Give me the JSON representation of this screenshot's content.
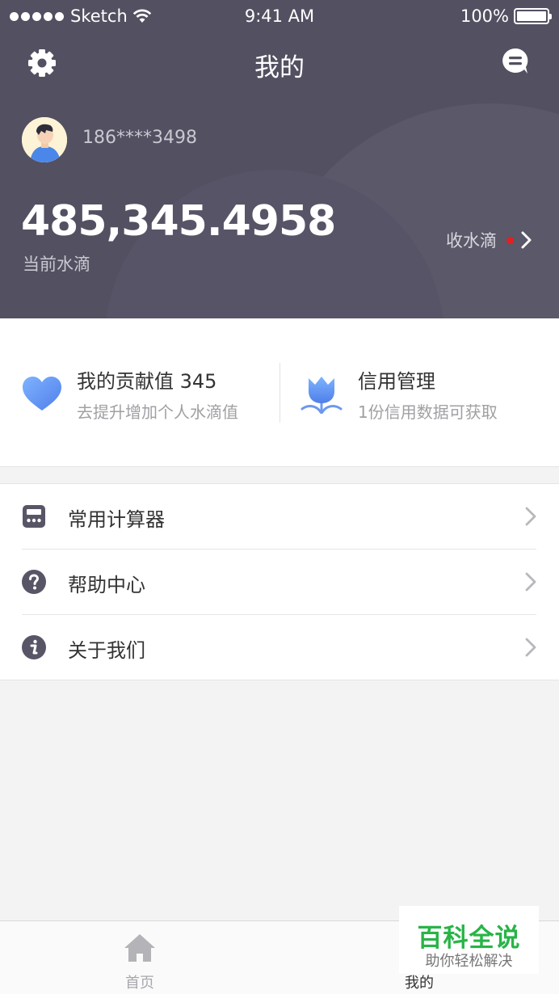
{
  "status_bar": {
    "carrier": "Sketch",
    "time": "9:41 AM",
    "battery": "100%"
  },
  "header": {
    "title": "我的",
    "settings_icon": "gear-icon",
    "message_icon": "message-icon",
    "phone": "186****3498",
    "balance": "485,345.4958",
    "balance_label": "当前水滴",
    "collect_label": "收水滴",
    "colors": {
      "background": "#525061",
      "dot": "#e0211e"
    }
  },
  "cards": [
    {
      "icon": "heart-icon",
      "title": "我的贡献值 345",
      "subtitle": "去提升增加个人水滴值"
    },
    {
      "icon": "tulip-icon",
      "title": "信用管理",
      "subtitle": "1份信用数据可获取"
    }
  ],
  "menu": [
    {
      "icon": "calculator-icon",
      "label": "常用计算器"
    },
    {
      "icon": "question-icon",
      "label": "帮助中心"
    },
    {
      "icon": "info-icon",
      "label": "关于我们"
    }
  ],
  "tabbar": {
    "home_label": "首页",
    "mine_label": "我的"
  },
  "watermark": {
    "title": "百科全说",
    "subtitle": "助你轻松解决"
  }
}
